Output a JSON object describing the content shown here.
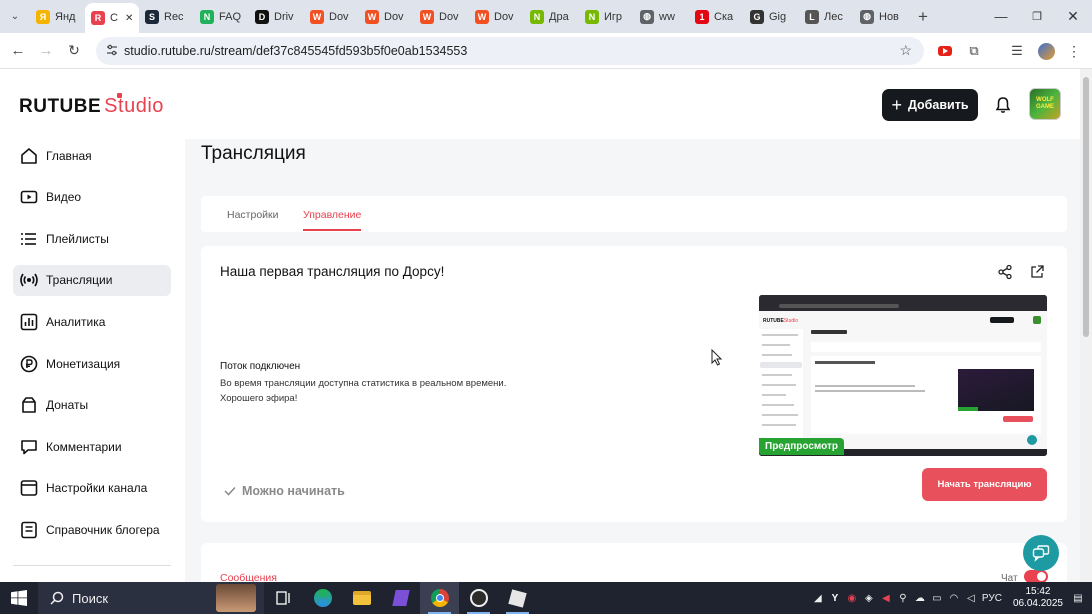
{
  "browser": {
    "tabs": [
      {
        "label": "Янд",
        "color": "#f5b400",
        "glyph": "Я"
      },
      {
        "label": "С",
        "color": "#e8424f",
        "glyph": "R",
        "active": true
      },
      {
        "label": "Rec",
        "color": "#1b2838",
        "glyph": "S"
      },
      {
        "label": "FAQ",
        "color": "#20b15a",
        "glyph": "N"
      },
      {
        "label": "Driv",
        "color": "#111111",
        "glyph": "D"
      },
      {
        "label": "Dov",
        "color": "#f25022",
        "glyph": "W"
      },
      {
        "label": "Dov",
        "color": "#f25022",
        "glyph": "W"
      },
      {
        "label": "Dov",
        "color": "#f25022",
        "glyph": "W"
      },
      {
        "label": "Dov",
        "color": "#f25022",
        "glyph": "W"
      },
      {
        "label": "Дра",
        "color": "#76b900",
        "glyph": "N"
      },
      {
        "label": "Игр",
        "color": "#76b900",
        "glyph": "N"
      },
      {
        "label": "ww",
        "color": "#5f6368",
        "glyph": "◍"
      },
      {
        "label": "Ска",
        "color": "#e30613",
        "glyph": "1"
      },
      {
        "label": "Gig",
        "color": "#333333",
        "glyph": "G"
      },
      {
        "label": "Лес",
        "color": "#555555",
        "glyph": "L"
      },
      {
        "label": "Нов",
        "color": "#5f6368",
        "glyph": "◍"
      }
    ],
    "new_tab_label": "+",
    "url": "studio.rutube.ru/stream/def37c845545fd593b5f0e0ab1534553"
  },
  "header": {
    "logo_text": "RUTUBE",
    "logo_studio": "Studio",
    "add_button": "Добавить",
    "avatar_text": "WOLF GAME"
  },
  "sidebar": {
    "items": [
      {
        "label": "Главная",
        "icon": "home-icon"
      },
      {
        "label": "Видео",
        "icon": "video-icon"
      },
      {
        "label": "Плейлисты",
        "icon": "playlist-icon"
      },
      {
        "label": "Трансляции",
        "icon": "broadcast-icon",
        "active": true
      },
      {
        "label": "Аналитика",
        "icon": "analytics-icon"
      },
      {
        "label": "Монетизация",
        "icon": "ruble-icon"
      },
      {
        "label": "Донаты",
        "icon": "donate-icon"
      },
      {
        "label": "Комментарии",
        "icon": "comment-icon"
      },
      {
        "label": "Настройки канала",
        "icon": "settings-icon"
      },
      {
        "label": "Справочник блогера",
        "icon": "help-icon"
      }
    ]
  },
  "main": {
    "title": "Трансляция",
    "tabs": [
      {
        "label": "Настройки"
      },
      {
        "label": "Управление",
        "active": true
      }
    ],
    "stream": {
      "title": "Наша первая трансляция по Дорсу!",
      "status_head": "Поток подключен",
      "status_line1": "Во время трансляции доступна статистика в реальном времени.",
      "status_line2": "Хорошего эфира!",
      "preview_label": "Предпросмотр",
      "ready_label": "Можно начинать",
      "start_button": "Начать трансляцию"
    },
    "messages_tab": "Сообщения",
    "chat_label": "Чат"
  },
  "taskbar": {
    "search_placeholder": "Поиск",
    "lang": "РУС",
    "time": "15:42",
    "date": "06.04.2025"
  },
  "colors": {
    "accent": "#e8424f",
    "dark_button": "#16191d",
    "preview_badge": "#26a331",
    "support": "#1e9aa3"
  }
}
